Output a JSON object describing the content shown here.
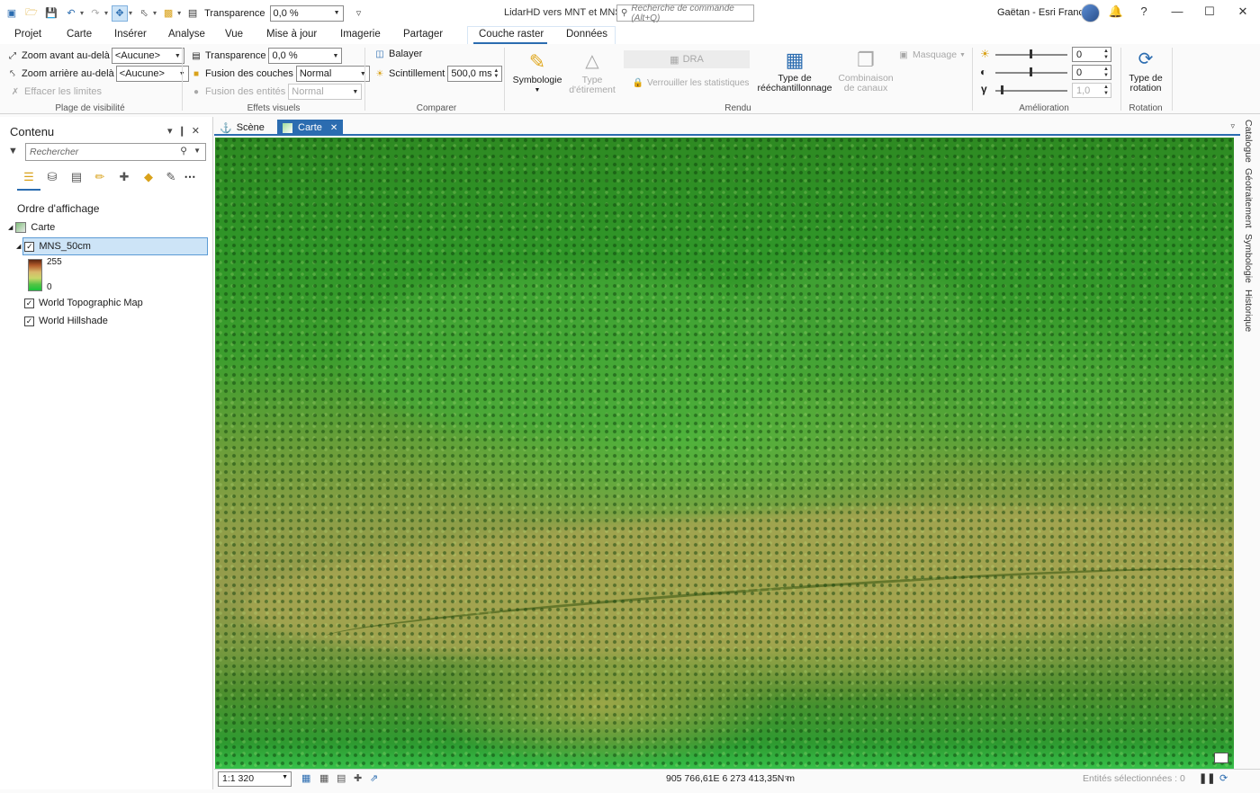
{
  "titlebar": {
    "transparency_label": "Transparence",
    "transparency_value": "0,0 %",
    "app_title": "LidarHD vers MNT et MNS",
    "command_search_placeholder": "Recherche de commande (Alt+Q)",
    "user_name": "Gaëtan - Esri France"
  },
  "ribbon_tabs": [
    "Projet",
    "Carte",
    "Insérer",
    "Analyse",
    "Vue",
    "Mise à jour",
    "Imagerie",
    "Partager",
    "Couche raster",
    "Données"
  ],
  "ribbon": {
    "visibility": {
      "zoom_in_beyond": "Zoom avant au-delà",
      "zoom_in_value": "<Aucune>",
      "zoom_out_beyond": "Zoom arrière au-delà",
      "zoom_out_value": "<Aucune>",
      "clear_limits": "Effacer les limites",
      "group_label": "Plage de visibilité"
    },
    "visual_effects": {
      "transparency": "Transparence",
      "transparency_value": "0,0 %",
      "layer_blend": "Fusion des couches",
      "layer_blend_value": "Normal",
      "feature_blend": "Fusion des entités",
      "feature_blend_value": "Normal",
      "group_label": "Effets visuels"
    },
    "compare": {
      "swipe": "Balayer",
      "flicker": "Scintillement",
      "flicker_value": "500,0  ms",
      "group_label": "Comparer"
    },
    "render": {
      "symbology": "Symbologie",
      "stretch_type_1": "Type",
      "stretch_type_2": "d'étirement",
      "dra": "DRA",
      "lock_stats": "Verrouiller les statistiques",
      "resampling_1": "Type de",
      "resampling_2": "rééchantillonnage",
      "band_combo_1": "Combinaison",
      "band_combo_2": "de canaux",
      "mask": "Masquage",
      "group_label": "Rendu"
    },
    "enhancement": {
      "brightness_value": "0",
      "contrast_value": "0",
      "gamma_value": "1,0",
      "group_label": "Amélioration"
    },
    "rotation": {
      "type_1": "Type de",
      "type_2": "rotation",
      "group_label": "Rotation"
    }
  },
  "contents": {
    "title": "Contenu",
    "search_placeholder": "Rechercher",
    "draw_order": "Ordre d'affichage",
    "map_name": "Carte",
    "layers": [
      {
        "name": "MNS_50cm",
        "checked": true,
        "selected": true
      },
      {
        "name": "World Topographic Map",
        "checked": true
      },
      {
        "name": "World Hillshade",
        "checked": true
      }
    ],
    "legend_max": "255",
    "legend_min": "0"
  },
  "map_tabs": [
    "Scène",
    "Carte"
  ],
  "right_dock": [
    "Catalogue",
    "Géotraitement",
    "Symbologie",
    "Historique"
  ],
  "statusbar": {
    "scale": "1:1 320",
    "coordinates": "905 766,61E 6 273 413,35N m",
    "selected_features": "Entités sélectionnées : 0"
  },
  "colors": {
    "accent": "#2b6cb0",
    "selection": "#cde4f7"
  }
}
